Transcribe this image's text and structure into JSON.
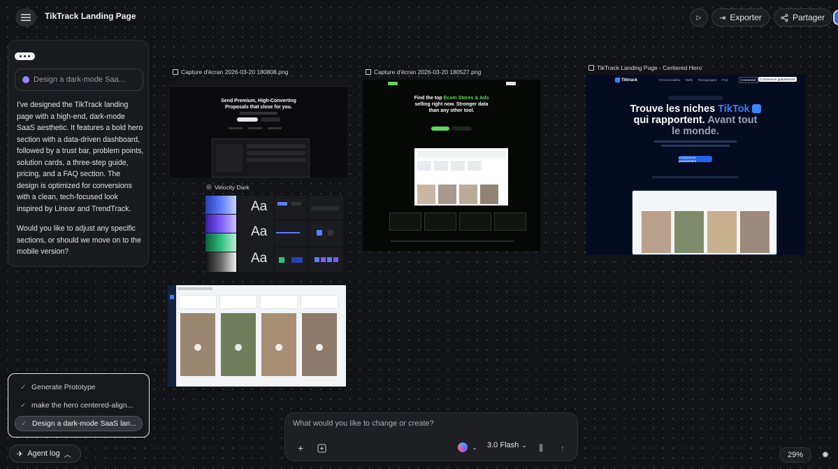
{
  "topbar": {
    "title": "TikTrack Landing Page",
    "export_label": "Exporter",
    "share_label": "Partager"
  },
  "chat": {
    "prompt_chip": "Design a dark-mode Saa...",
    "message_1": "I've designed the TikTrack landing page with a high-end, dark-mode SaaS aesthetic. It features a bold hero section with a data-driven dashboard, followed by a trust bar, problem points, solution cards, a three-step guide, pricing, and a FAQ section. The design is optimized for conversions with a clean, tech-focused look inspired by Linear and TrendTrack.",
    "message_2": "Would you like to adjust any specific sections, or should we move on to the mobile version?"
  },
  "suggestions": [
    {
      "label": "Generate Prototype"
    },
    {
      "label": "make the hero centered-align..."
    },
    {
      "label": "Design a dark-mode SaaS lan..."
    }
  ],
  "agent_log_label": "Agent log",
  "composer": {
    "placeholder": "What would you like to change or create?",
    "model": "3.0 Flash"
  },
  "zoom": "29%",
  "canvas": {
    "frame1": {
      "label": "Capture d'écran 2026-03-20 180808.png",
      "headline_1": "Send Premium, High-Converting",
      "headline_2": "Proposals that close for you."
    },
    "frame2": {
      "label": "Capture d'écran 2026-03-20 180527.png",
      "headline_a": "Find the top ",
      "headline_b": "Ecom Stores & Ads",
      "headline_c": "selling right now. Stronger data",
      "headline_d": "than any other tool."
    },
    "frame3": {
      "label": "TikTrack Landing Page - Centered Hero",
      "brand": "Tiktrack",
      "nav": [
        "Fonctionnalités",
        "Tarifs",
        "Témoignages",
        "FAQ"
      ],
      "login": "Connexion",
      "cta_top": "Commencer gratuitement",
      "headline_1a": "Trouve les niches ",
      "headline_1b": "TikTok",
      "headline_2a": "qui rapportent. ",
      "headline_2b": "Avant tout",
      "headline_3": "le monde.",
      "cta": "Commencer gratuitement"
    },
    "frame4": {
      "label": "Velocity Dark",
      "aa": "Aa"
    }
  },
  "colors": {
    "background": "#121316",
    "accent_blue": "#3b82f6",
    "accent_green": "#5cd65c"
  }
}
